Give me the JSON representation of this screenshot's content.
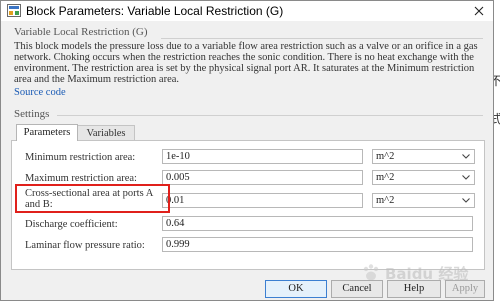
{
  "window": {
    "title": "Block Parameters: Variable Local Restriction (G)"
  },
  "background": {
    "glyph_top": "不",
    "glyph_bottom": "式"
  },
  "block": {
    "heading": "Variable Local Restriction (G)",
    "description": "This block models the pressure loss due to a variable flow area restriction such as a valve or an orifice in a gas network. Choking occurs when the restriction reaches the sonic condition. There is no heat exchange with the environment. The restriction area is set by the physical signal port AR. It saturates at the Minimum restriction area and the Maximum restriction area.",
    "source_link": "Source code"
  },
  "settings": {
    "heading": "Settings",
    "tabs": [
      {
        "label": "Parameters"
      },
      {
        "label": "Variables"
      }
    ],
    "params": [
      {
        "label": "Minimum restriction area:",
        "value": "1e-10",
        "unit": "m^2"
      },
      {
        "label": "Maximum restriction area:",
        "value": "0.005",
        "unit": "m^2"
      },
      {
        "label": "Cross-sectional area at ports A and B:",
        "value": "0.01",
        "unit": "m^2"
      },
      {
        "label": "Discharge coefficient:",
        "value": "0.64"
      },
      {
        "label": "Laminar flow pressure ratio:",
        "value": "0.999"
      }
    ]
  },
  "buttons": {
    "ok": "OK",
    "cancel": "Cancel",
    "help": "Help",
    "apply": "Apply"
  },
  "watermark": {
    "text": "Baidu 经验"
  },
  "colors": {
    "highlight": "#e0201b",
    "link": "#1a5bb5"
  }
}
